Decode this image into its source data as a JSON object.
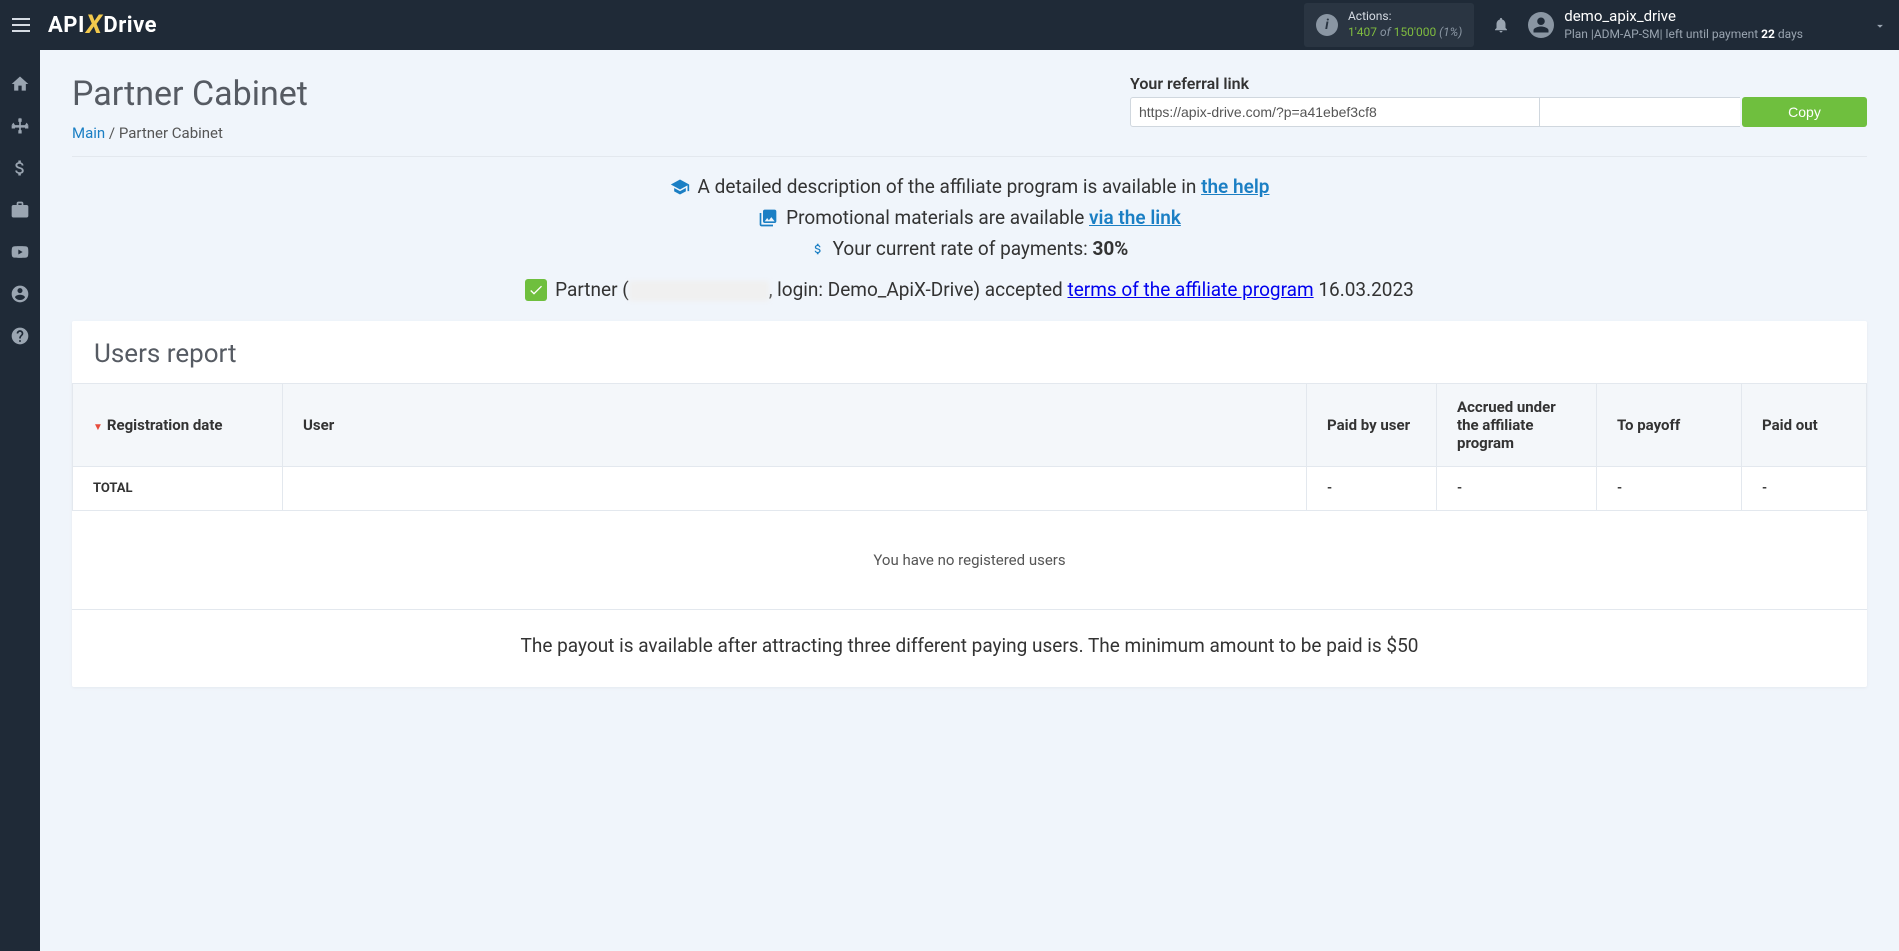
{
  "header": {
    "actions": {
      "label": "Actions:",
      "current": "1'407",
      "of": " of ",
      "max": "150'000",
      "pct": " (1%)"
    },
    "user": {
      "name": "demo_apix_drive",
      "plan_prefix": "Plan |",
      "plan_code": "ADM-AP-SM",
      "plan_suffix": "| left until payment ",
      "days": "22",
      "days_label": " days"
    }
  },
  "page": {
    "title": "Partner Cabinet",
    "breadcrumb": {
      "main": "Main",
      "sep": " / ",
      "current": "Partner Cabinet"
    }
  },
  "referral": {
    "label": "Your referral link",
    "value": "https://apix-drive.com/?p=a41ebef3cf8",
    "copy": "Copy"
  },
  "info": {
    "line1_a": "A detailed description of the affiliate program is available in ",
    "line1_link": "the help",
    "line2_a": "Promotional materials are available ",
    "line2_link": "via the link",
    "line3_a": "Your current rate of payments: ",
    "line3_b": "30%",
    "partner_a": "Partner (",
    "partner_b": ", login: Demo_ApiX-Drive) accepted ",
    "partner_link": "terms of the affiliate program",
    "partner_date": " 16.03.2023"
  },
  "report": {
    "title": "Users report",
    "cols": {
      "reg": "Registration date",
      "user": "User",
      "paid_by": "Paid by user",
      "accrued": "Accrued under the affiliate program",
      "to_payoff": "To payoff",
      "paid_out": "Paid out"
    },
    "total": {
      "label": "TOTAL",
      "paid_by": "-",
      "accrued": "-",
      "to_payoff": "-",
      "paid_out": "-"
    },
    "empty": "You have no registered users",
    "note": "The payout is available after attracting three different paying users. The minimum amount to be paid is $50"
  }
}
